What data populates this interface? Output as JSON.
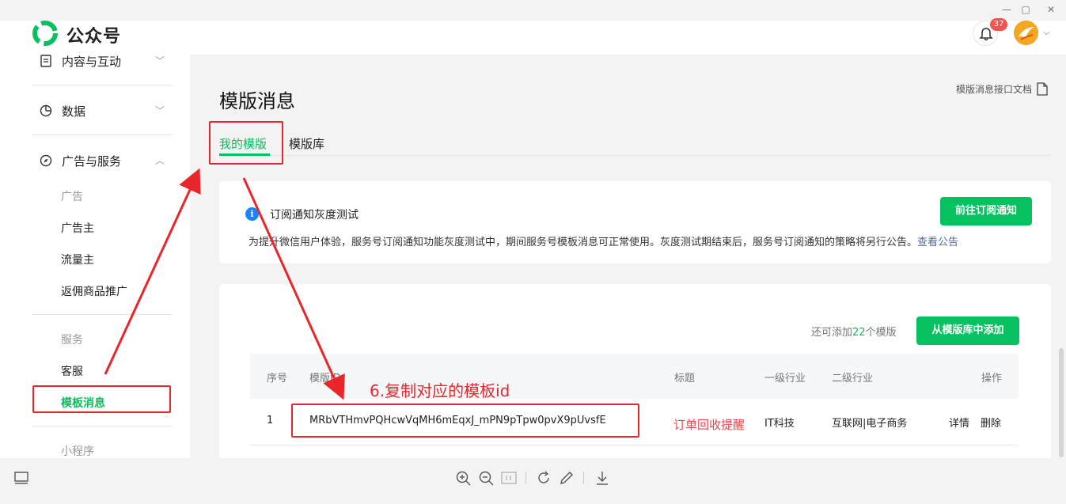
{
  "app": {
    "title": "公众号"
  },
  "header": {
    "notification_count": "37"
  },
  "sidebar": {
    "groups": [
      {
        "label": "内容与互动"
      },
      {
        "label": "数据"
      },
      {
        "label": "广告与服务"
      }
    ],
    "ad_section": "广告",
    "ad_items": [
      "广告主",
      "流量主",
      "返佣商品推广"
    ],
    "service_section": "服务",
    "service_items": [
      "客服",
      "模板消息"
    ],
    "mini_section": "小程序"
  },
  "main": {
    "page_title": "模版消息",
    "doc_link": "模版消息接口文档",
    "tabs": [
      {
        "label": "我的模版",
        "active": true
      },
      {
        "label": "模版库",
        "active": false
      }
    ],
    "notice": {
      "title": "订阅通知灰度测试",
      "body": "为提升微信用户体验，服务号订阅通知功能灰度测试中，期间服务号模板消息可正常使用。灰度测试期结束后，服务号订阅通知的策略将另行公告。",
      "link": "查看公告",
      "button": "前往订阅通知"
    },
    "remain_prefix": "还可添加",
    "remain_count": "22",
    "remain_suffix": "个模版",
    "add_button": "从模版库中添加",
    "table": {
      "columns": [
        "序号",
        "模版ID",
        "标题",
        "一级行业",
        "二级行业",
        "操作"
      ],
      "rows": [
        {
          "index": "1",
          "template_id": "MRbVTHmvPQHcwVqMH6mEqxJ_mPN9pTpw0pvX9pUvsfE",
          "title": "订单回收提醒",
          "industry1": "IT科技",
          "industry2": "互联网|电子商务",
          "action_detail": "详情",
          "action_delete": "删除"
        }
      ]
    }
  },
  "annotation": {
    "text": "6.复制对应的模板id"
  },
  "colors": {
    "brand": "#07c160",
    "annotation": "#e8262c",
    "link": "#576b95",
    "info": "#1a84ff"
  },
  "toolbar": {
    "icons": [
      "zoom-in-icon",
      "zoom-out-icon",
      "actual-size-icon",
      "rotate-icon",
      "edit-icon",
      "download-icon"
    ]
  }
}
